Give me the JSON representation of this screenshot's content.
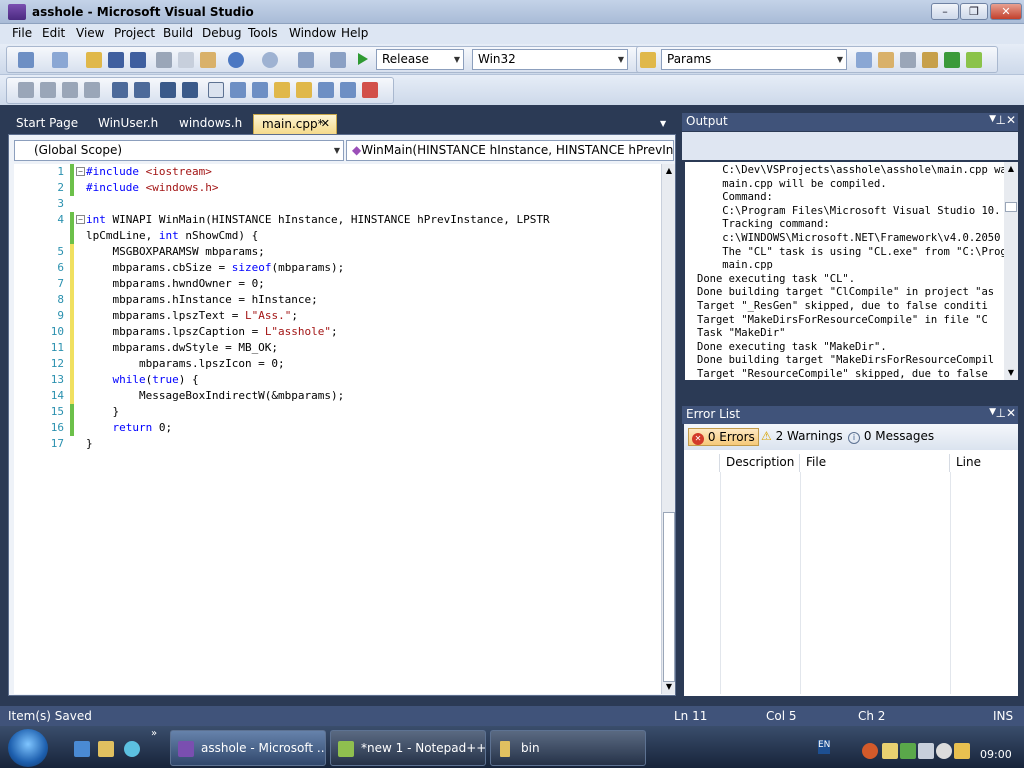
{
  "window": {
    "title": "asshole - Microsoft Visual Studio",
    "minimize": "–",
    "maximize": "❐",
    "close": "✕"
  },
  "menu": [
    "File",
    "Edit",
    "View",
    "Project",
    "Build",
    "Debug",
    "Tools",
    "Window",
    "Help"
  ],
  "toolbar": {
    "configuration": "Release",
    "platform": "Win32",
    "find": "Params"
  },
  "tabs": [
    {
      "label": "Start Page"
    },
    {
      "label": "WinUser.h"
    },
    {
      "label": "windows.h"
    },
    {
      "label": "main.cpp*",
      "active": true,
      "close": "✕"
    }
  ],
  "editor": {
    "scope": "(Global Scope)",
    "function": "WinMain(HINSTANCE hInstance, HINSTANCE hPrevInstance",
    "lines": [
      {
        "n": "1",
        "t": "#include <iostream>"
      },
      {
        "n": "2",
        "t": "#include <windows.h>"
      },
      {
        "n": "3",
        "t": ""
      },
      {
        "n": "4",
        "t": "int WINAPI WinMain(HINSTANCE hInstance, HINSTANCE hPrevInstance, LPSTR"
      },
      {
        "n": "",
        "t": "lpCmdLine, int nShowCmd) {"
      },
      {
        "n": "5",
        "t": "    MSGBOXPARAMSW mbparams;"
      },
      {
        "n": "6",
        "t": "    mbparams.cbSize = sizeof(mbparams);"
      },
      {
        "n": "7",
        "t": "    mbparams.hwndOwner = 0;"
      },
      {
        "n": "8",
        "t": "    mbparams.hInstance = hInstance;"
      },
      {
        "n": "9",
        "t": "    mbparams.lpszText = L\"Ass.\";"
      },
      {
        "n": "10",
        "t": "    mbparams.lpszCaption = L\"asshole\";"
      },
      {
        "n": "11",
        "t": "    mbparams.dwStyle = MB_OK;"
      },
      {
        "n": "12",
        "t": "        mbparams.lpszIcon = 0;"
      },
      {
        "n": "13",
        "t": "    while(true) {"
      },
      {
        "n": "14",
        "t": "        MessageBoxIndirectW(&mbparams);"
      },
      {
        "n": "15",
        "t": "    }"
      },
      {
        "n": "16",
        "t": "    return 0;"
      },
      {
        "n": "17",
        "t": "}"
      }
    ]
  },
  "output": {
    "title": "Output",
    "lines": [
      "    C:\\Dev\\VSProjects\\asshole\\asshole\\main.cpp wa",
      "    main.cpp will be compiled.",
      "    Command:",
      "    C:\\Program Files\\Microsoft Visual Studio 10.",
      "    Tracking command:",
      "    c:\\WINDOWS\\Microsoft.NET\\Framework\\v4.0.2050",
      "    The \"CL\" task is using \"CL.exe\" from \"C:\\Prog",
      "    main.cpp",
      "Done executing task \"CL\".",
      "Done building target \"ClCompile\" in project \"as",
      "Target \"_ResGen\" skipped, due to false conditi",
      "Target \"MakeDirsForResourceCompile\" in file \"C",
      "Task \"MakeDir\"",
      "Done executing task \"MakeDir\".",
      "Done building target \"MakeDirsForResourceCompil",
      "Target \"ResourceCompile\" skipped, due to false"
    ]
  },
  "error_list": {
    "title": "Error List",
    "errors": "0 Errors",
    "warnings": "2 Warnings",
    "messages": "0 Messages",
    "columns": [
      "Description",
      "File",
      "Line"
    ]
  },
  "status": {
    "message": "Item(s) Saved",
    "ln": "Ln 11",
    "col": "Col 5",
    "ch": "Ch 2",
    "mode": "INS"
  },
  "taskbar": {
    "items": [
      "asshole - Microsoft ...",
      "*new  1 - Notepad++",
      "bin"
    ],
    "lang": "EN",
    "clock": "09:00"
  }
}
